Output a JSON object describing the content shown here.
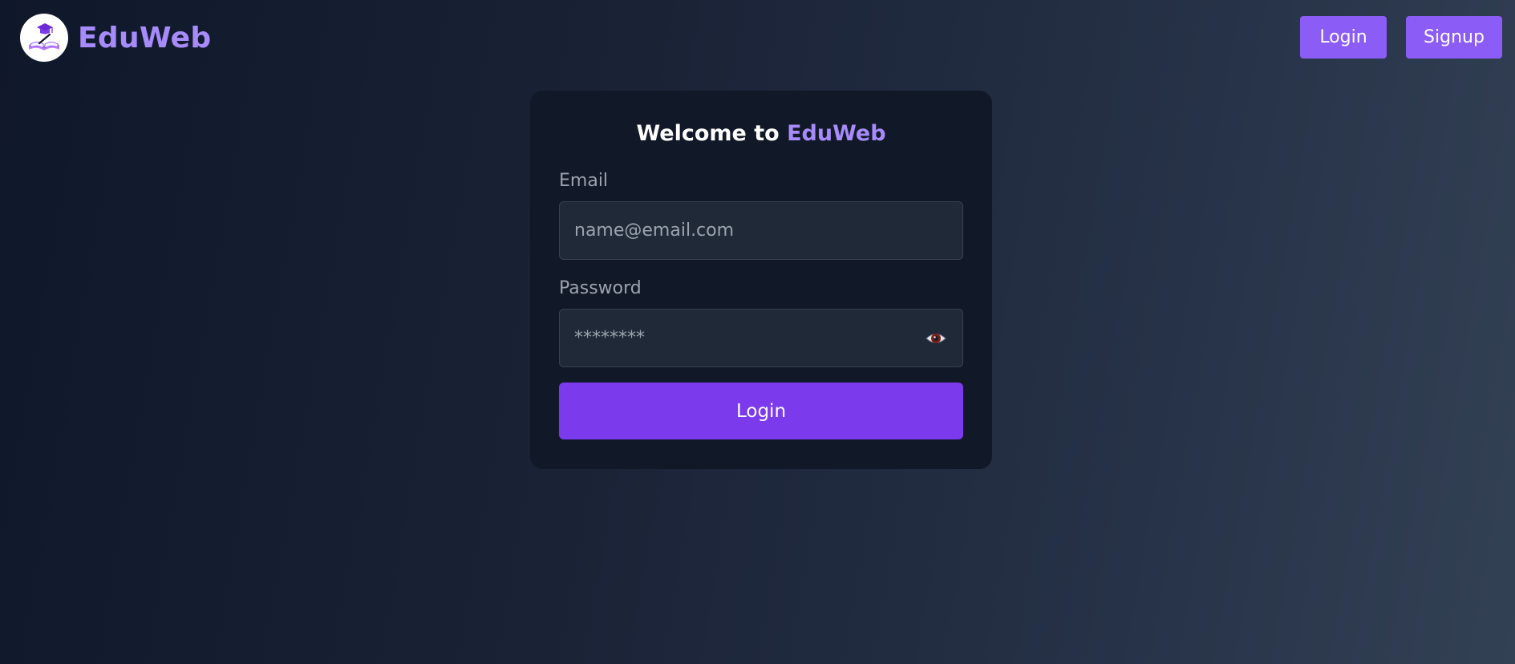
{
  "brand": {
    "name": "EduWeb",
    "logo_icon": "graduation-book-icon"
  },
  "nav": {
    "login_label": "Login",
    "signup_label": "Signup"
  },
  "form": {
    "title_prefix": "Welcome to ",
    "title_accent": "EduWeb",
    "email_label": "Email",
    "email_placeholder": "name@email.com",
    "password_label": "Password",
    "password_placeholder": "********",
    "show_password_icon": "eye-icon",
    "submit_label": "Login"
  },
  "colors": {
    "accent": "#a78bfa",
    "button": "#8b5cf6",
    "primary": "#7c3aed",
    "card": "#111827",
    "input": "#1f2937"
  }
}
